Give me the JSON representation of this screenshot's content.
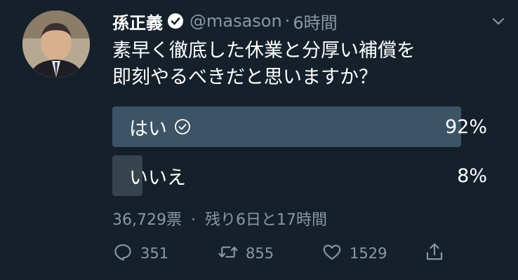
{
  "tweet": {
    "author_name": "孫正義",
    "handle": "@masason",
    "separator": "·",
    "time": "6時間",
    "text_line1": "素早く徹底した休業と分厚い補償を",
    "text_line2": "即刻やるべきだと思いますか？"
  },
  "poll": {
    "options": [
      {
        "label": "はい",
        "percent_label": "92%",
        "percent": 92,
        "winner": true
      },
      {
        "label": "いいえ",
        "percent_label": "8%",
        "percent": 8,
        "winner": false
      }
    ],
    "votes": "36,729票",
    "meta_separator": "·",
    "remaining": "残り6日と17時間"
  },
  "actions": {
    "replies": "351",
    "retweets": "855",
    "likes": "1529"
  },
  "colors": {
    "background": "#15202b",
    "bar_winner": "#3d5466",
    "bar_other": "#38444d",
    "secondary_text": "#8899a6"
  },
  "icons": [
    "verified-badge-icon",
    "chevron-down-icon",
    "check-circle-icon",
    "reply-icon",
    "retweet-icon",
    "heart-icon",
    "share-icon"
  ]
}
